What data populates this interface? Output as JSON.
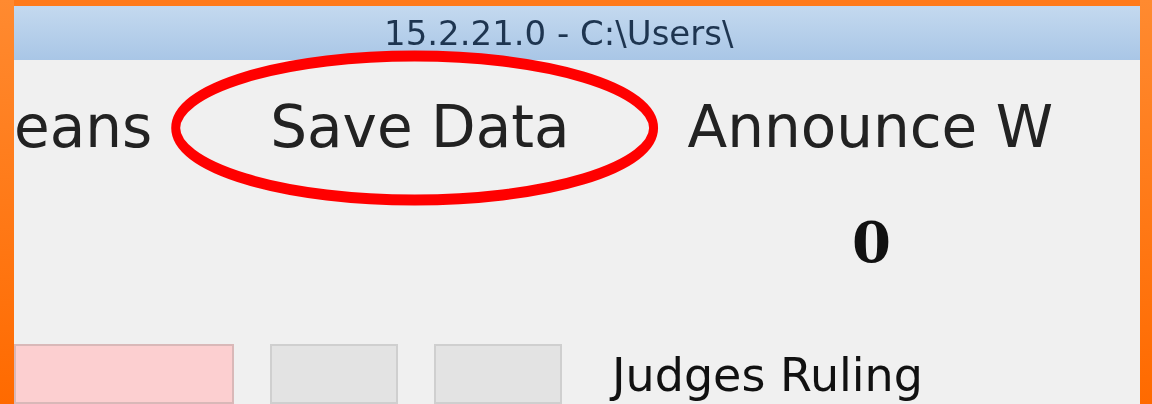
{
  "window": {
    "title": "15.2.21.0 - C:\\Users\\"
  },
  "menu": [
    {
      "label": "eans",
      "circled": false
    },
    {
      "label": "Save Data",
      "circled": true
    },
    {
      "label": "Announce W",
      "circled": false
    }
  ],
  "score": "0",
  "panels": [
    {
      "kind": "color",
      "color": "#fccfd0"
    },
    {
      "kind": "button"
    },
    {
      "kind": "button"
    }
  ],
  "ruling_label": "Judges Ruling"
}
